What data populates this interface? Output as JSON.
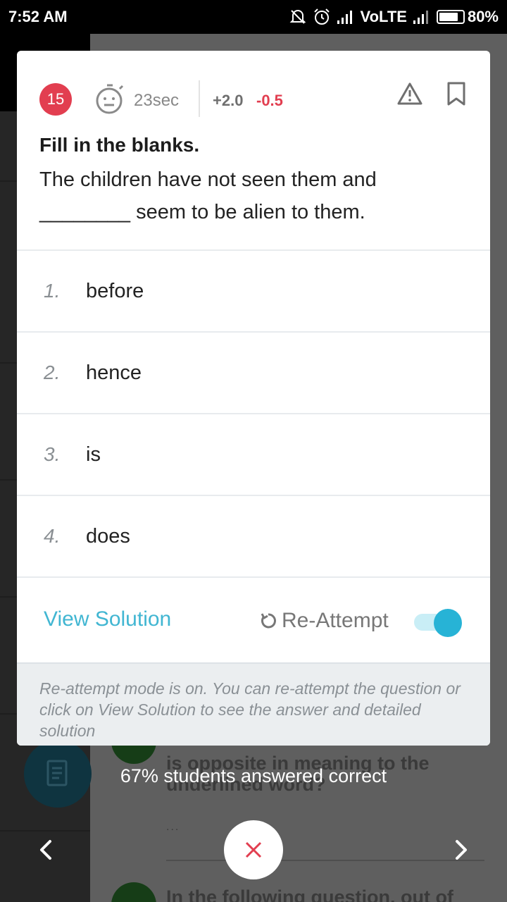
{
  "status_bar": {
    "time": "7:52 AM",
    "network": "VoLTE",
    "battery": "80%",
    "battery_level": 0.8
  },
  "question": {
    "number": "15",
    "timer": "23sec",
    "marks_positive": "+2.0",
    "marks_negative": "-0.5",
    "instruction": "Fill in the blanks.",
    "text": "The children have not seen them and ________ seem to be alien to them."
  },
  "options": [
    {
      "num": "1.",
      "text": "before"
    },
    {
      "num": "2.",
      "text": "hence"
    },
    {
      "num": "3.",
      "text": "is"
    },
    {
      "num": "4.",
      "text": "does"
    }
  ],
  "actions": {
    "view_solution": "View Solution",
    "reattempt": "Re-Attempt",
    "reattempt_on": true
  },
  "info": "Re-attempt mode is on. You can re-attempt the question or click on View Solution to see the answer and detailed solution",
  "stats": "67% students answered correct",
  "background": {
    "q1_text": "is opposite in meaning to the underlined word?",
    "dots": "...",
    "q2_text": "In the following question, out of"
  },
  "colors": {
    "accent": "#41b6d2",
    "danger": "#e23e50",
    "toggle": "#27b3d6"
  },
  "icons": [
    "timer-icon",
    "warning-icon",
    "bookmark-icon",
    "reattempt-icon",
    "close-icon",
    "chevron-left-icon",
    "chevron-right-icon"
  ]
}
